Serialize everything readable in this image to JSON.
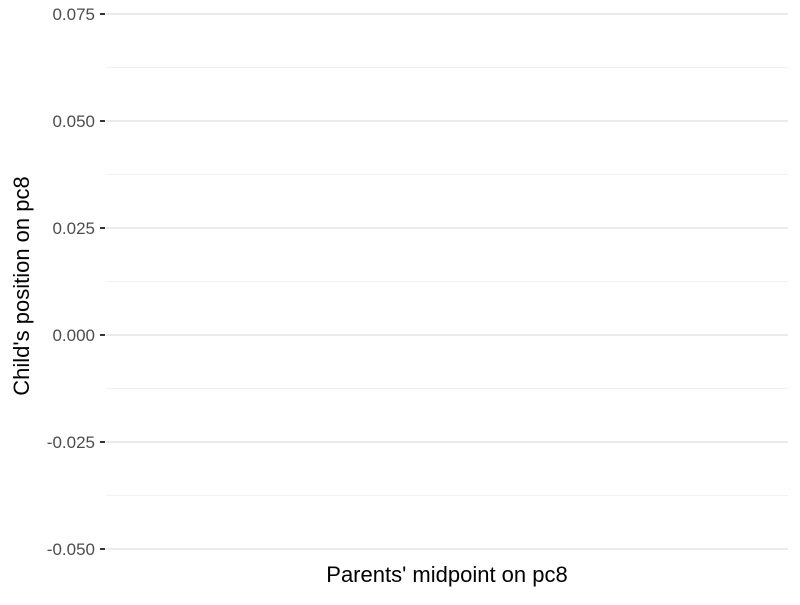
{
  "chart_data": {
    "type": "scatter",
    "title": "",
    "xlabel": "Parents' midpoint on pc8",
    "ylabel": "Child's position on pc8",
    "ylim": [
      -0.05,
      0.075
    ],
    "y_ticks": [
      {
        "value": -0.05,
        "label": "-0.050"
      },
      {
        "value": -0.025,
        "label": "-0.025"
      },
      {
        "value": 0.0,
        "label": "0.000"
      },
      {
        "value": 0.025,
        "label": "0.025"
      },
      {
        "value": 0.05,
        "label": "0.050"
      },
      {
        "value": 0.075,
        "label": "0.075"
      }
    ],
    "x_ticks": [],
    "series": [],
    "grid": true,
    "colors": {
      "grid_major": "#ebebeb",
      "grid_minor": "#f2f2f2",
      "tick_mark": "#333333",
      "tick_text": "#4d4d4d",
      "title_text": "#000000"
    }
  }
}
